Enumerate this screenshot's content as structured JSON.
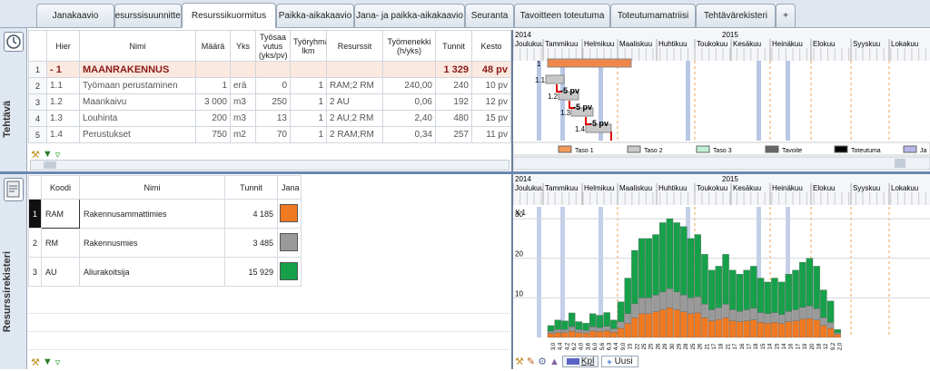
{
  "tabs": [
    {
      "label": "Janakaavio"
    },
    {
      "label": "Resurssisuunnittelu"
    },
    {
      "label": "Resurssikuormitus"
    },
    {
      "label": "Paikka-aikakaavio"
    },
    {
      "label": "Jana- ja paikka-aikakaavio"
    },
    {
      "label": "Seuranta"
    },
    {
      "label": "Tavoitteen toteutuma"
    },
    {
      "label": "Toteutumamatriisi"
    },
    {
      "label": "Tehtävärekisteri"
    },
    {
      "label": "+"
    }
  ],
  "tasks": {
    "side_label": "Tehtävä",
    "columns": {
      "hier": "Hier",
      "nimi": "Nimi",
      "maara": "Määrä",
      "yks": "Yks",
      "tyosaavutus": "Työsaa vutus (yks/pv)",
      "ryhma": "Työryhmä lkm",
      "resurssit": "Resurssit",
      "tyomenekki": "Työmenekki (h/yks)",
      "tunnit": "Tunnit",
      "kesto": "Kesto"
    },
    "rows": [
      {
        "rn": "1",
        "hier": "- 1",
        "nimi": "MAANRAKENNUS",
        "maara": "",
        "yks": "",
        "tyosaavutus": "",
        "ryhma": "",
        "resurssit": "",
        "tyomenekki": "",
        "tunnit": "1 329",
        "kesto": "48 pv"
      },
      {
        "rn": "2",
        "hier": "1.1",
        "nimi": "Työmaan perustaminen",
        "maara": "1",
        "yks": "erä",
        "tyosaavutus": "0",
        "ryhma": "1",
        "resurssit": "RAM;2 RM",
        "tyomenekki": "240,00",
        "tunnit": "240",
        "kesto": "10 pv"
      },
      {
        "rn": "3",
        "hier": "1.2",
        "nimi": "Maankaivu",
        "maara": "3 000",
        "yks": "m3",
        "tyosaavutus": "250",
        "ryhma": "1",
        "resurssit": "2 AU",
        "tyomenekki": "0,06",
        "tunnit": "192",
        "kesto": "12 pv"
      },
      {
        "rn": "4",
        "hier": "1.3",
        "nimi": "Louhinta",
        "maara": "200",
        "yks": "m3",
        "tyosaavutus": "13",
        "ryhma": "1",
        "resurssit": "2 AU;2 RM",
        "tyomenekki": "2,40",
        "tunnit": "480",
        "kesto": "15 pv"
      },
      {
        "rn": "5",
        "hier": "1.4",
        "nimi": "Perustukset",
        "maara": "750",
        "yks": "m2",
        "tyosaavutus": "70",
        "ryhma": "1",
        "resurssit": "2 RAM;RM",
        "tyomenekki": "0,34",
        "tunnit": "257",
        "kesto": "11 pv"
      }
    ]
  },
  "resources": {
    "side_label": "Resurssirekisteri",
    "columns": {
      "koodi": "Koodi",
      "nimi": "Nimi",
      "tunnit": "Tunnit",
      "jana": "Jana"
    },
    "rows": [
      {
        "rn": "1",
        "koodi": "RAM",
        "nimi": "Rakennusammattimies",
        "tunnit": "4 185",
        "color": "#f07a22"
      },
      {
        "rn": "2",
        "koodi": "RM",
        "nimi": "Rakennusmies",
        "tunnit": "3 485",
        "color": "#9a9a9a"
      },
      {
        "rn": "3",
        "koodi": "AU",
        "nimi": "Aliurakoitsija",
        "tunnit": "15 929",
        "color": "#17a04a"
      }
    ]
  },
  "gantt": {
    "year_left": "2014",
    "year_right": "2015",
    "months": [
      "Joulukuu",
      "Tammikuu",
      "Helmikuu",
      "Maaliskuu",
      "Huhtikuu",
      "Toukokuu",
      "Kesäkuu",
      "Heinäkuu",
      "Elokuu",
      "Syyskuu",
      "Lokakuu"
    ],
    "bar_labels": [
      "1",
      "1.1",
      "1.2",
      "1.3",
      "1.4"
    ],
    "lags": [
      "-5 pv",
      "-5 pv",
      "-5 pv"
    ],
    "legend": [
      {
        "label": "Taso 1",
        "color": "#f39a5a"
      },
      {
        "label": "Taso 2",
        "color": "#c8c8c8"
      },
      {
        "label": "Taso 3",
        "color": "#bff0d4"
      },
      {
        "label": "Tavoite",
        "color": "#666666"
      },
      {
        "label": "Toteutuma",
        "color": "#000000"
      },
      {
        "label": "Ja",
        "color": "#b6b6e8"
      }
    ]
  },
  "chart_data": {
    "type": "bar",
    "stacked": true,
    "ylabel": "X 1",
    "yticks": [
      10,
      20,
      30
    ],
    "ylim": [
      0,
      33
    ],
    "categories": [
      "3,0",
      "4,4",
      "4,2",
      "6,2",
      "4,0",
      "3,6",
      "6,0",
      "5,6",
      "6,3",
      "4,4",
      "9,0",
      "15",
      "22",
      "25",
      "25",
      "26",
      "29",
      "30",
      "29",
      "28",
      "25",
      "26",
      "21",
      "17",
      "18",
      "21",
      "17",
      "16",
      "17",
      "18",
      "15",
      "14",
      "15",
      "14",
      "16",
      "17",
      "19",
      "20",
      "18",
      "12",
      "9,2",
      "2,0"
    ],
    "series": [
      {
        "name": "RAM",
        "color": "#f07a22",
        "values": [
          1.0,
          1.2,
          1.2,
          1.6,
          1.2,
          1.1,
          1.6,
          1.5,
          1.7,
          1.3,
          2.3,
          3.5,
          5,
          6,
          6,
          6.5,
          7,
          7.5,
          7,
          6.5,
          6,
          6.2,
          5,
          4.2,
          4.5,
          5,
          4.2,
          4,
          4.2,
          4.4,
          3.8,
          3.6,
          3.8,
          3.5,
          4,
          4.2,
          4.6,
          4.8,
          4.4,
          3,
          2.3,
          0.8
        ]
      },
      {
        "name": "RM",
        "color": "#9a9a9a",
        "values": [
          0.6,
          0.8,
          0.8,
          1.1,
          0.8,
          0.7,
          1.1,
          1.0,
          1.1,
          0.9,
          1.7,
          2.5,
          3.5,
          4,
          4,
          4.2,
          4.5,
          4.8,
          4.5,
          4.2,
          4,
          4.1,
          3.4,
          2.8,
          3,
          3.4,
          2.8,
          2.6,
          2.8,
          3,
          2.5,
          2.4,
          2.5,
          2.3,
          2.6,
          2.8,
          3,
          3.2,
          2.9,
          2,
          1.5,
          0.4
        ]
      },
      {
        "name": "AU",
        "color": "#17a04a",
        "values": [
          1.4,
          2.4,
          2.2,
          3.5,
          2.0,
          1.8,
          3.3,
          3.1,
          3.5,
          2.2,
          5.0,
          9,
          13.5,
          15,
          15,
          15.3,
          17.5,
          17.7,
          17.5,
          17.3,
          15,
          15.7,
          12.6,
          10,
          10.5,
          12.6,
          10,
          9.4,
          10,
          10.6,
          8.7,
          8,
          8.7,
          8.2,
          9.4,
          10,
          11.4,
          12,
          10.7,
          7,
          5.4,
          0.8
        ]
      }
    ]
  },
  "bottom": {
    "kpl_label": "Kpl",
    "uusi_label": "Uusi"
  }
}
